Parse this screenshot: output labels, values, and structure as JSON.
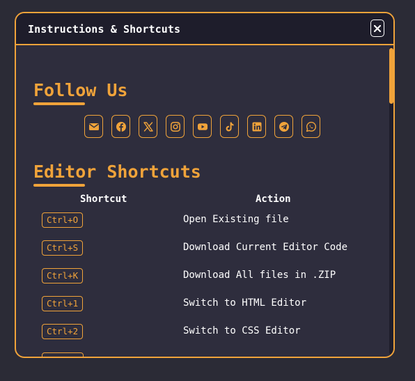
{
  "modal": {
    "title": "Instructions & Shortcuts",
    "close_label": "×"
  },
  "follow": {
    "heading": "Follow Us",
    "icons": [
      "email-icon",
      "facebook-icon",
      "x-icon",
      "instagram-icon",
      "youtube-icon",
      "tiktok-icon",
      "linkedin-icon",
      "telegram-icon",
      "whatsapp-icon"
    ]
  },
  "shortcuts": {
    "heading": "Editor Shortcuts",
    "col_shortcut": "Shortcut",
    "col_action": "Action",
    "rows": [
      {
        "key": "Ctrl+O",
        "action": "Open Existing file"
      },
      {
        "key": "Ctrl+S",
        "action": "Download Current Editor Code"
      },
      {
        "key": "Ctrl+K",
        "action": "Download All files in .ZIP"
      },
      {
        "key": "Ctrl+1",
        "action": "Switch to HTML Editor"
      },
      {
        "key": "Ctrl+2",
        "action": "Switch to CSS Editor"
      }
    ]
  },
  "colors": {
    "accent": "#f0a33a",
    "panel": "#2e2d3d",
    "header": "#1e1d2b",
    "background": "#2b2b36"
  }
}
